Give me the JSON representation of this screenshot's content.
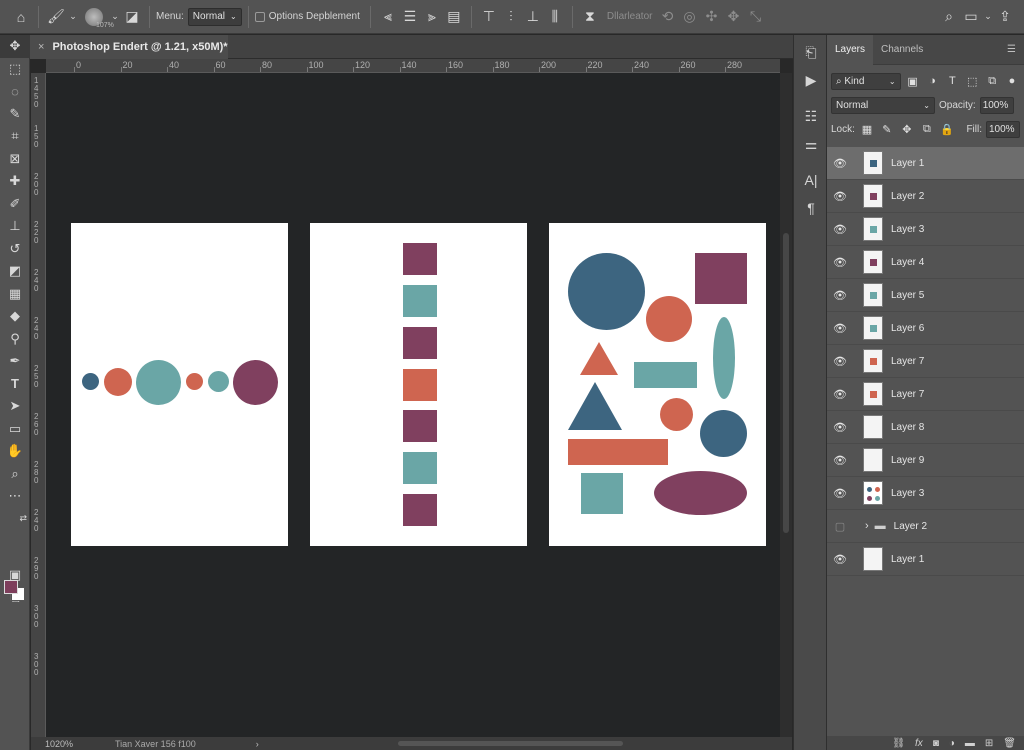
{
  "options_bar": {
    "brush_size": "107%",
    "menu_label": "Menu:",
    "mode_value": "Normal",
    "option_label": "Options Depblement",
    "distribute_label": "Dllarleator"
  },
  "document": {
    "tab_title": "Photoshop Endert @ 1.21, x50M)*",
    "close_glyph": "×"
  },
  "ruler": {
    "top_labels": [
      "0",
      "20",
      "40",
      "60",
      "80",
      "100",
      "120",
      "140",
      "160",
      "180",
      "200",
      "220",
      "240",
      "260",
      "280"
    ],
    "left_labels": [
      "1 4 5 0",
      "1 5 0",
      "2 0 0",
      "2 2 0",
      "2 4 0",
      "2 4 0",
      "2 5 0",
      "2 6 0",
      "2 8 0",
      "2 4 0",
      "2 9 0",
      "3 0 0",
      "3 0 0"
    ]
  },
  "status": {
    "zoom": "1020%",
    "info": "Tian Xaver 156 f100",
    "arrow": "›"
  },
  "colors": {
    "foreground": "#7e3f5c",
    "background": "#ffffff",
    "navy": "#3d6580",
    "coral": "#cf6550",
    "teal": "#6aa6a6",
    "plum": "#80405f"
  },
  "layers_panel": {
    "tab_layers": "Layers",
    "tab_channels": "Channels",
    "filter_kind": "Kind",
    "blend_mode": "Normal",
    "opacity_label": "Opacity:",
    "opacity_value": "100%",
    "lock_label": "Lock:",
    "fill_label": "Fill:",
    "fill_value": "100%",
    "layers": [
      {
        "name": "Layer 1",
        "visible": true
      },
      {
        "name": "Layer 2",
        "visible": true
      },
      {
        "name": "Layer 3",
        "visible": true
      },
      {
        "name": "Layer 4",
        "visible": true
      },
      {
        "name": "Layer 5",
        "visible": true
      },
      {
        "name": "Layer 6",
        "visible": true
      },
      {
        "name": "Layer 7",
        "visible": true
      },
      {
        "name": "Layer 7",
        "visible": true
      },
      {
        "name": "Layer 8",
        "visible": true
      },
      {
        "name": "Layer 9",
        "visible": true
      },
      {
        "name": "Layer 3",
        "visible": true
      },
      {
        "name": "Layer 2",
        "visible": false,
        "group": true
      },
      {
        "name": "Layer 1",
        "visible": true
      }
    ],
    "footer_fx": "fx"
  }
}
